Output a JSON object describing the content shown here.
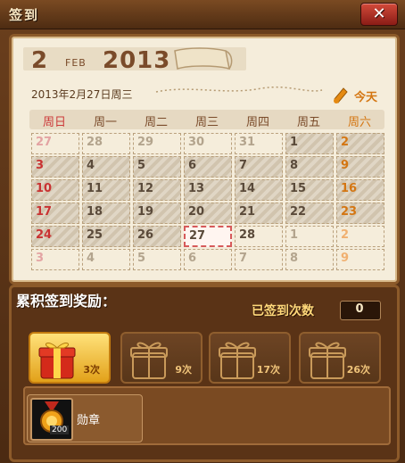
{
  "window": {
    "title": "签到",
    "close_label": "✕"
  },
  "calendar": {
    "month": "2",
    "month_abbr": "FEB",
    "year": "2013",
    "date_line": "2013年2月27日周三",
    "today_label": "今天",
    "weekdays": [
      "周日",
      "周一",
      "周二",
      "周三",
      "周四",
      "周五",
      "周六"
    ],
    "rows": [
      [
        {
          "d": "27",
          "fade": true
        },
        {
          "d": "28",
          "fade": true
        },
        {
          "d": "29",
          "fade": true
        },
        {
          "d": "30",
          "fade": true
        },
        {
          "d": "31",
          "fade": true
        },
        {
          "d": "1",
          "stripe": true
        },
        {
          "d": "2",
          "stripe": true
        }
      ],
      [
        {
          "d": "3",
          "stripe": true
        },
        {
          "d": "4",
          "stripe": true
        },
        {
          "d": "5",
          "stripe": true
        },
        {
          "d": "6",
          "stripe": true
        },
        {
          "d": "7",
          "stripe": true
        },
        {
          "d": "8",
          "stripe": true
        },
        {
          "d": "9",
          "stripe": true
        }
      ],
      [
        {
          "d": "10",
          "stripe": true
        },
        {
          "d": "11",
          "stripe": true
        },
        {
          "d": "12",
          "stripe": true
        },
        {
          "d": "13",
          "stripe": true
        },
        {
          "d": "14",
          "stripe": true
        },
        {
          "d": "15",
          "stripe": true
        },
        {
          "d": "16",
          "stripe": true
        }
      ],
      [
        {
          "d": "17",
          "stripe": true
        },
        {
          "d": "18",
          "stripe": true
        },
        {
          "d": "19",
          "stripe": true
        },
        {
          "d": "20",
          "stripe": true
        },
        {
          "d": "21",
          "stripe": true
        },
        {
          "d": "22",
          "stripe": true
        },
        {
          "d": "23",
          "stripe": true
        }
      ],
      [
        {
          "d": "24",
          "stripe": true
        },
        {
          "d": "25",
          "stripe": true
        },
        {
          "d": "26",
          "stripe": true
        },
        {
          "d": "27",
          "today": true
        },
        {
          "d": "28"
        },
        {
          "d": "1",
          "fade": true
        },
        {
          "d": "2",
          "fade": true
        }
      ],
      [
        {
          "d": "3",
          "fade": true
        },
        {
          "d": "4",
          "fade": true
        },
        {
          "d": "5",
          "fade": true
        },
        {
          "d": "6",
          "fade": true
        },
        {
          "d": "7",
          "fade": true
        },
        {
          "d": "8",
          "fade": true
        },
        {
          "d": "9",
          "fade": true
        }
      ]
    ]
  },
  "rewards": {
    "title": "累积签到奖励：",
    "signed_label": "已签到次数",
    "signed_count": "0",
    "gifts": [
      {
        "label": "3次",
        "active": true
      },
      {
        "label": "9次",
        "active": false
      },
      {
        "label": "17次",
        "active": false
      },
      {
        "label": "26次",
        "active": false
      }
    ],
    "item": {
      "name": "勋章",
      "count": "200"
    }
  },
  "colors": {
    "accent_orange": "#d47612",
    "sunday_red": "#c93232",
    "frame_brown": "#8c5a2a"
  }
}
